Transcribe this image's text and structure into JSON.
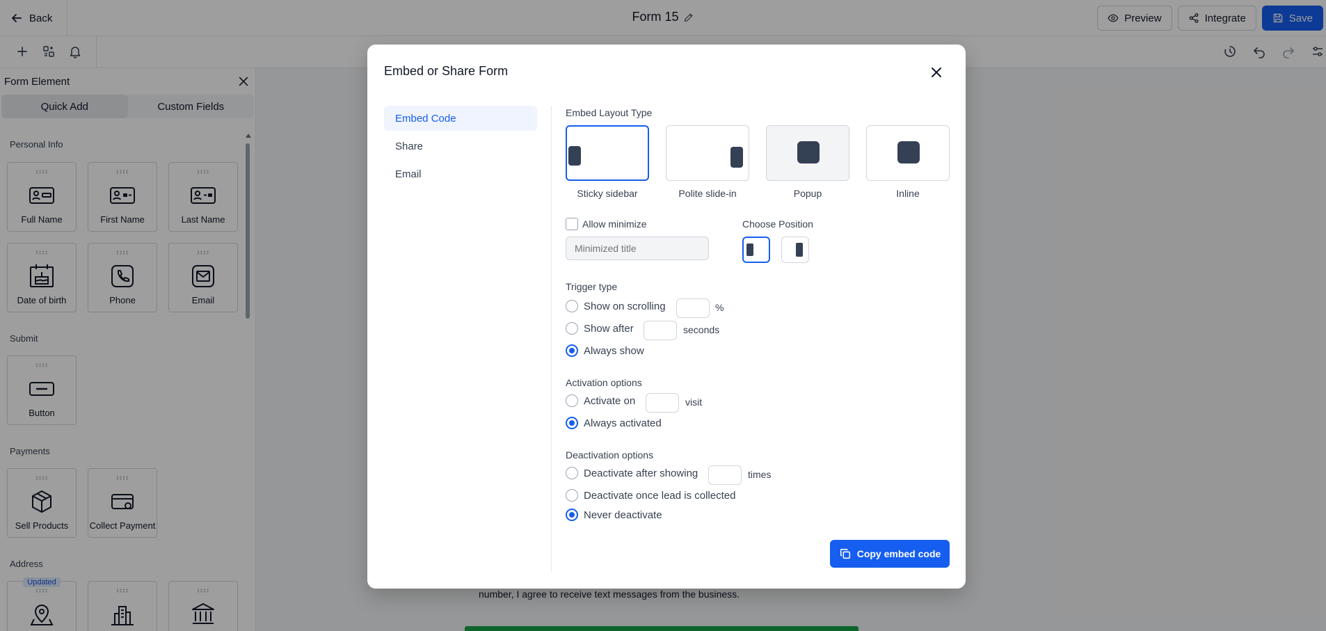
{
  "topbar": {
    "back_label": "Back",
    "form_title": "Form 15",
    "preview_label": "Preview",
    "integrate_label": "Integrate",
    "save_label": "Save"
  },
  "left_panel": {
    "title": "Form Element",
    "tabs": [
      "Quick Add",
      "Custom Fields"
    ],
    "sections": {
      "personal_info": "Personal Info",
      "submit": "Submit",
      "payments": "Payments",
      "address": "Address"
    },
    "items": {
      "full_name": "Full Name",
      "first_name": "First Name",
      "last_name": "Last Name",
      "date_of_birth": "Date of birth",
      "phone": "Phone",
      "email": "Email",
      "button": "Button",
      "sell_products": "Sell Products",
      "collect_payment": "Collect Payment",
      "updated_badge": "Updated"
    }
  },
  "canvas": {
    "consent_text": "number, I agree to receive text messages from the business."
  },
  "modal": {
    "title": "Embed or Share Form",
    "nav": [
      "Embed Code",
      "Share",
      "Email"
    ],
    "embed_layout_label": "Embed Layout Type",
    "layouts": [
      "Sticky sidebar",
      "Polite slide-in",
      "Popup",
      "Inline"
    ],
    "allow_minimize_label": "Allow minimize",
    "minimized_title_placeholder": "Minimized title",
    "choose_position_label": "Choose Position",
    "trigger": {
      "label": "Trigger type",
      "show_on_scrolling": "Show on scrolling",
      "percent_unit": "%",
      "show_after": "Show after",
      "seconds_unit": "seconds",
      "always_show": "Always show"
    },
    "activation": {
      "label": "Activation options",
      "activate_on": "Activate on",
      "visit_unit": "visit",
      "always_activated": "Always activated"
    },
    "deactivation": {
      "label": "Deactivation options",
      "after_showing": "Deactivate after showing",
      "times_unit": "times",
      "once_lead": "Deactivate once lead is collected",
      "never": "Never deactivate"
    },
    "copy_button_label": "Copy embed code"
  },
  "colors": {
    "primary": "#155eef",
    "mark": "#344054",
    "green": "#16a34a"
  }
}
